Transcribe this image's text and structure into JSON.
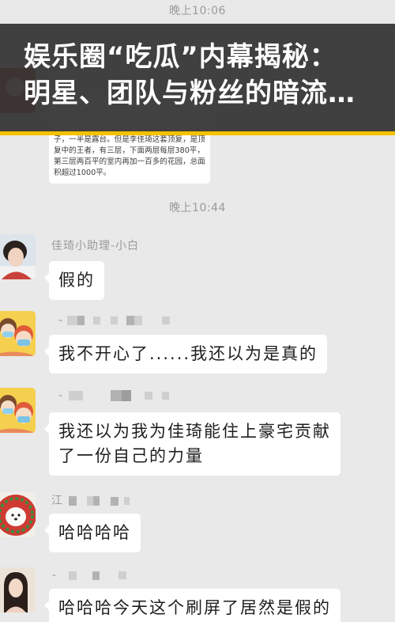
{
  "colors": {
    "page_background": "#e9e9e9",
    "bubble_background": "#ffffff",
    "bubble_text": "#1e1e1e",
    "meta_text": "#9a9a9a",
    "banner_background": "#333333",
    "banner_text": "#ffffff",
    "banner_accent": "#f5c200"
  },
  "banner": {
    "title_lines": [
      "娱乐圈“吃瓜”内幕揭秘：",
      "明星、团队与粉丝的暗流…"
    ]
  },
  "chat": {
    "timestamps": [
      "晚上10:06",
      "晚上10:44"
    ],
    "earlier_message": {
      "avatar": "earlier-sender-avatar",
      "lines": [
        "子，一半是露台。但是李佳琦这套顶复，是顶",
        "复中的王者，有三层，下面两层每层380平，",
        "第三层两百平的室内再加一百多的花园，总面",
        "积超过1000平。"
      ]
    },
    "messages": [
      {
        "avatar": "person-photo-avatar",
        "sender": "佳琦小助理-小白",
        "lines": [
          "假的"
        ]
      },
      {
        "avatar": "masked-kids-cartoon-avatar",
        "sender": "-",
        "lines": [
          "我不开心了......我还以为是真的"
        ]
      },
      {
        "avatar": "masked-kids-cartoon-avatar",
        "sender": "-",
        "lines": [
          "我还以为我为佳琦能住上豪宅贡献",
          "了一份自己的力量"
        ]
      },
      {
        "avatar": "dog-wreath-avatar",
        "sender": "江",
        "lines": [
          "哈哈哈哈"
        ]
      },
      {
        "avatar": "woman-photo-avatar",
        "sender": "-",
        "lines": [
          "哈哈哈今天这个刷屏了居然是假的"
        ]
      }
    ]
  }
}
